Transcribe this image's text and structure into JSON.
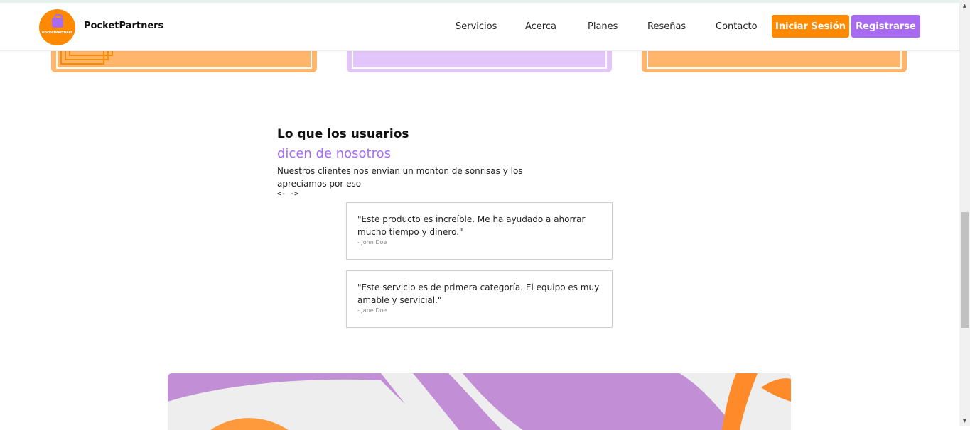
{
  "header": {
    "logo_text": "PocketPartners",
    "brand_name": "PocketPartners",
    "nav": [
      {
        "label": "Servicios"
      },
      {
        "label": "Acerca"
      },
      {
        "label": "Planes"
      },
      {
        "label": "Reseñas"
      },
      {
        "label": "Contacto"
      }
    ],
    "login_label": "Iniciar Sesión",
    "register_label": "Registrarse"
  },
  "testimonials": {
    "title": "Lo que los usuarios",
    "subtitle": "dicen de nosotros",
    "description": "Nuestros clientes nos envian un monton de sonrisas y los apreciamos por eso",
    "prev_arrow": "<-",
    "next_arrow": "->",
    "reviews": [
      {
        "quote": "\"Este producto es increíble. Me ha ayudado a ahorrar mucho tiempo y dinero.\"",
        "author": "- John Doe"
      },
      {
        "quote": "\"Este servicio es de primera categoría. El equipo es muy amable y servicial.\"",
        "author": "- Jane Doe"
      }
    ]
  },
  "colors": {
    "orange": "#ff8a00",
    "purple": "#a86af0",
    "card_orange": "#ffb56b",
    "card_purple": "#e2c6fa",
    "banner_purple": "#c28fd6"
  },
  "icons": {
    "scroll_up": "scroll-up-arrow-icon",
    "scroll_down": "scroll-down-arrow-icon"
  }
}
